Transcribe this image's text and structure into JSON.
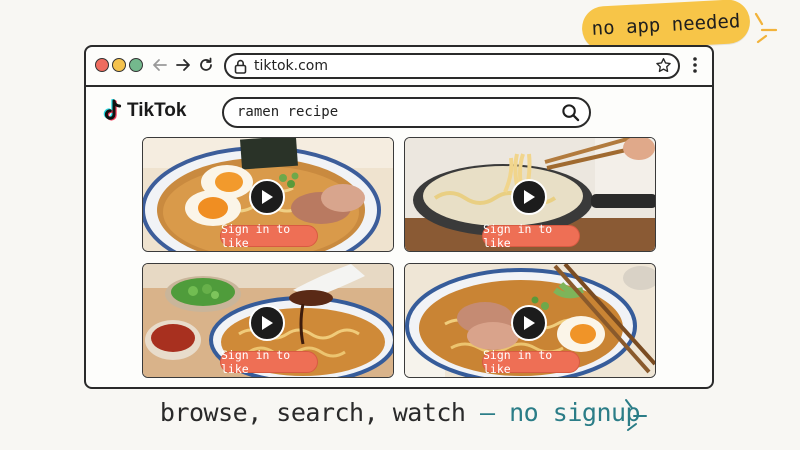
{
  "sticker": {
    "text": "no app needed",
    "color": "#f7c548"
  },
  "browser": {
    "url": "tiktok.com",
    "traffic_lights": [
      "#ef6b5e",
      "#f4c24e",
      "#74b88d"
    ],
    "icons": [
      "back-arrow-icon",
      "forward-arrow-icon",
      "reload-icon",
      "lock-icon",
      "star-icon",
      "kebab-menu-icon"
    ]
  },
  "page": {
    "logo_text": "TikTok",
    "search": {
      "value": "ramen recipe",
      "icon": "search-icon"
    },
    "videos": [
      {
        "subject": "ramen-bowl-with-eggs",
        "button": "Sign in to like"
      },
      {
        "subject": "noodles-in-pot",
        "button": "Sign in to like"
      },
      {
        "subject": "soy-sauce-spoon-over-ramen",
        "button": "Sign in to like"
      },
      {
        "subject": "ramen-with-chopsticks",
        "button": "Sign in to like"
      }
    ],
    "pill_color": "#ee6f55"
  },
  "caption": {
    "main": "browse, search, watch",
    "accent": "— no signup",
    "accent_color": "#2b7d87"
  }
}
